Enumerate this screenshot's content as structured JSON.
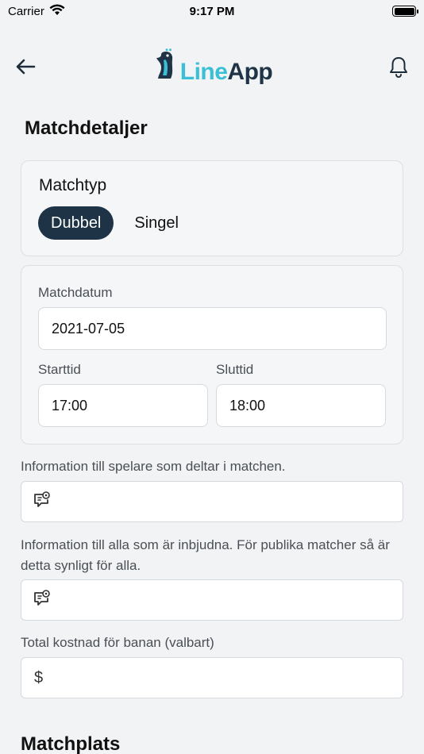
{
  "status_bar": {
    "carrier": "Carrier",
    "time": "9:17 PM"
  },
  "header": {
    "logo_line": "Line",
    "logo_app": "App"
  },
  "page": {
    "title": "Matchdetaljer",
    "section2_title": "Matchplats"
  },
  "match_type": {
    "label": "Matchtyp",
    "options": [
      "Dubbel",
      "Singel"
    ],
    "selected": "Dubbel"
  },
  "schedule": {
    "date_label": "Matchdatum",
    "date_value": "2021-07-05",
    "start_label": "Starttid",
    "start_value": "17:00",
    "end_label": "Sluttid",
    "end_value": "18:00"
  },
  "info_players": {
    "label": "Information till spelare som deltar i matchen.",
    "value": ""
  },
  "info_invited": {
    "label": "Information till alla som är inbjudna. För publika matcher så är detta synligt för alla.",
    "value": ""
  },
  "cost": {
    "label": "Total kostnad för banan (valbart)",
    "currency_symbol": "$",
    "value": ""
  },
  "colors": {
    "primary": "#1e3346",
    "accent": "#3bbfd6",
    "background": "#f2f3f5"
  }
}
